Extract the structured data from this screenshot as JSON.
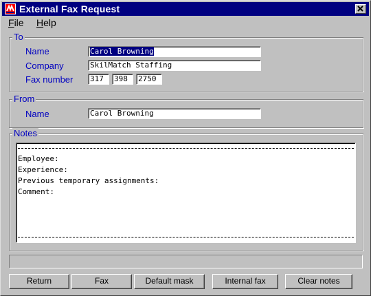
{
  "window": {
    "title": "External Fax Request",
    "app_icon": "fax-app-icon",
    "close_icon": "close-icon"
  },
  "menu": {
    "items": [
      "File",
      "Help"
    ]
  },
  "to": {
    "legend": "To",
    "name_label": "Name",
    "name_value": "Carol Browning",
    "company_label": "Company",
    "company_value": "SkilMatch Staffing",
    "fax_label": "Fax number",
    "fax_area": "317",
    "fax_prefix": "398",
    "fax_line": "2750"
  },
  "from": {
    "legend": "From",
    "name_label": "Name",
    "name_value": "Carol Browning"
  },
  "notes": {
    "legend": "Notes",
    "lines": [
      "Employee:",
      "Experience:",
      "Previous temporary assignments:",
      "Comment:"
    ]
  },
  "status": {
    "text": ""
  },
  "buttons": {
    "return": "Return",
    "fax": "Fax",
    "default_mask": "Default mask",
    "internal_fax": "Internal fax",
    "clear_notes": "Clear notes"
  },
  "colors": {
    "titlebar": "#000080",
    "face": "#c0c0c0",
    "label": "#0000c0",
    "selection": "#000080"
  }
}
